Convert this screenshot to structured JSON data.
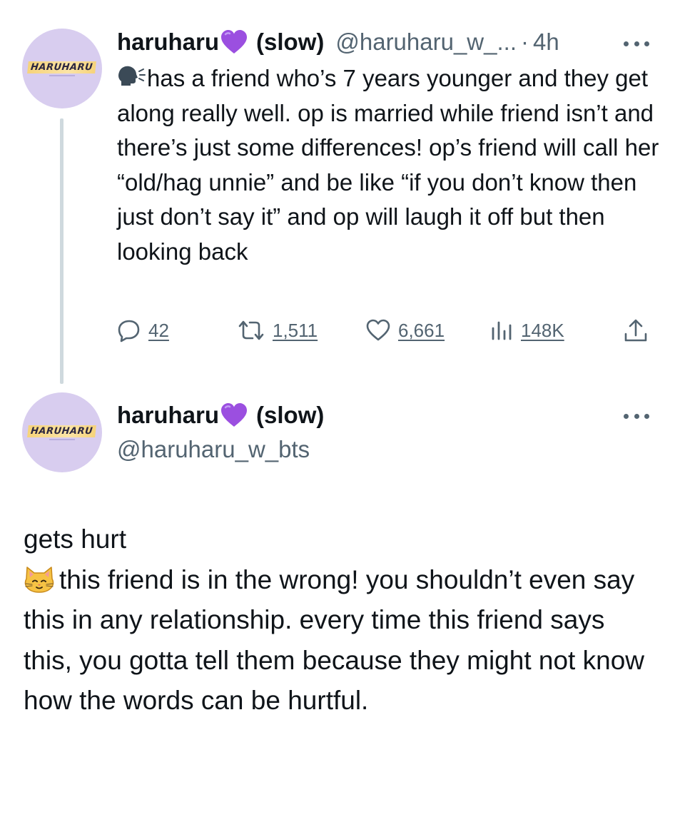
{
  "tweet1": {
    "avatar_text": "HARUHARU",
    "display_name": "haruharu",
    "name_suffix": "(slow)",
    "handle": "@haruharu_w_...",
    "separator": "·",
    "time": "4h",
    "text": "has a friend who’s 7 years younger and they get along really well. op is married while friend isn’t and there’s just some differences! op’s friend will call her “old/hag unnie” and be like “if you don’t know then just don’t say it” and op will laugh it off but then looking back",
    "icons": {
      "speaking": "speaking-head-icon",
      "heart": "purple-heart-icon",
      "more": "more-icon"
    },
    "stats": {
      "replies": "42",
      "retweets": "1,511",
      "likes": "6,661",
      "views": "148K"
    }
  },
  "tweet2": {
    "avatar_text": "HARUHARU",
    "display_name": "haruharu",
    "name_suffix": "(slow)",
    "handle": "@haruharu_w_bts",
    "line1": "gets hurt",
    "text": "this friend is in the wrong! you shouldn’t even say this in any relationship. every time this friend says this, you gotta tell them because they might not know how the words can be hurtful.",
    "icons": {
      "cat": "cat-face-icon",
      "heart": "purple-heart-icon",
      "more": "more-icon"
    }
  },
  "colors": {
    "text": "#0f1419",
    "muted": "#536471",
    "thread_line": "#cfd9de",
    "avatar_bg": "#d8cdef",
    "heart": "#9b4fe0"
  }
}
